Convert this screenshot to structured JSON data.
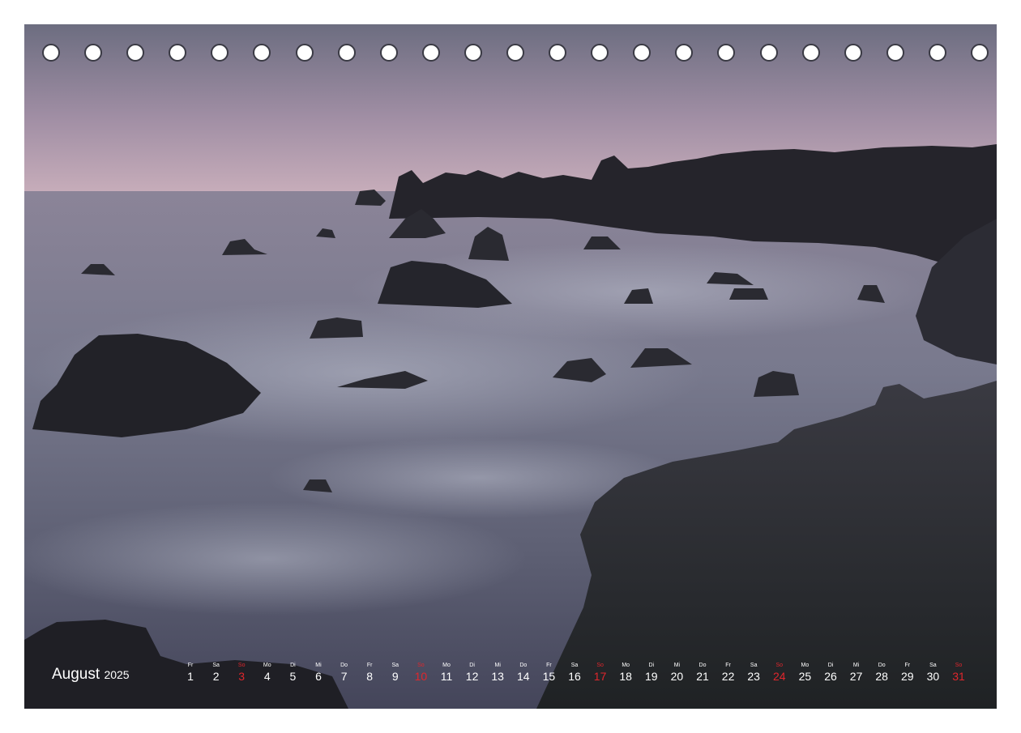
{
  "month_label": "August",
  "year_label": "2025",
  "hole_count": 23,
  "colors": {
    "sunday": "#e0262c",
    "text": "#ffffff",
    "sky_top": "#6e6f82",
    "sky_horizon": "#c2a9b8",
    "sea": "#6f7286",
    "rock": "#1f1e24"
  },
  "days": [
    {
      "wd": "Fr",
      "num": "1",
      "red": false
    },
    {
      "wd": "Sa",
      "num": "2",
      "red": false
    },
    {
      "wd": "So",
      "num": "3",
      "red": true
    },
    {
      "wd": "Mo",
      "num": "4",
      "red": false
    },
    {
      "wd": "Di",
      "num": "5",
      "red": false
    },
    {
      "wd": "Mi",
      "num": "6",
      "red": false
    },
    {
      "wd": "Do",
      "num": "7",
      "red": false
    },
    {
      "wd": "Fr",
      "num": "8",
      "red": false
    },
    {
      "wd": "Sa",
      "num": "9",
      "red": false
    },
    {
      "wd": "So",
      "num": "10",
      "red": true
    },
    {
      "wd": "Mo",
      "num": "11",
      "red": false
    },
    {
      "wd": "Di",
      "num": "12",
      "red": false
    },
    {
      "wd": "Mi",
      "num": "13",
      "red": false
    },
    {
      "wd": "Do",
      "num": "14",
      "red": false
    },
    {
      "wd": "Fr",
      "num": "15",
      "red": false
    },
    {
      "wd": "Sa",
      "num": "16",
      "red": false
    },
    {
      "wd": "So",
      "num": "17",
      "red": true
    },
    {
      "wd": "Mo",
      "num": "18",
      "red": false
    },
    {
      "wd": "Di",
      "num": "19",
      "red": false
    },
    {
      "wd": "Mi",
      "num": "20",
      "red": false
    },
    {
      "wd": "Do",
      "num": "21",
      "red": false
    },
    {
      "wd": "Fr",
      "num": "22",
      "red": false
    },
    {
      "wd": "Sa",
      "num": "23",
      "red": false
    },
    {
      "wd": "So",
      "num": "24",
      "red": true
    },
    {
      "wd": "Mo",
      "num": "25",
      "red": false
    },
    {
      "wd": "Di",
      "num": "26",
      "red": false
    },
    {
      "wd": "Mi",
      "num": "27",
      "red": false
    },
    {
      "wd": "Do",
      "num": "28",
      "red": false
    },
    {
      "wd": "Fr",
      "num": "29",
      "red": false
    },
    {
      "wd": "Sa",
      "num": "30",
      "red": false
    },
    {
      "wd": "So",
      "num": "31",
      "red": true
    }
  ]
}
